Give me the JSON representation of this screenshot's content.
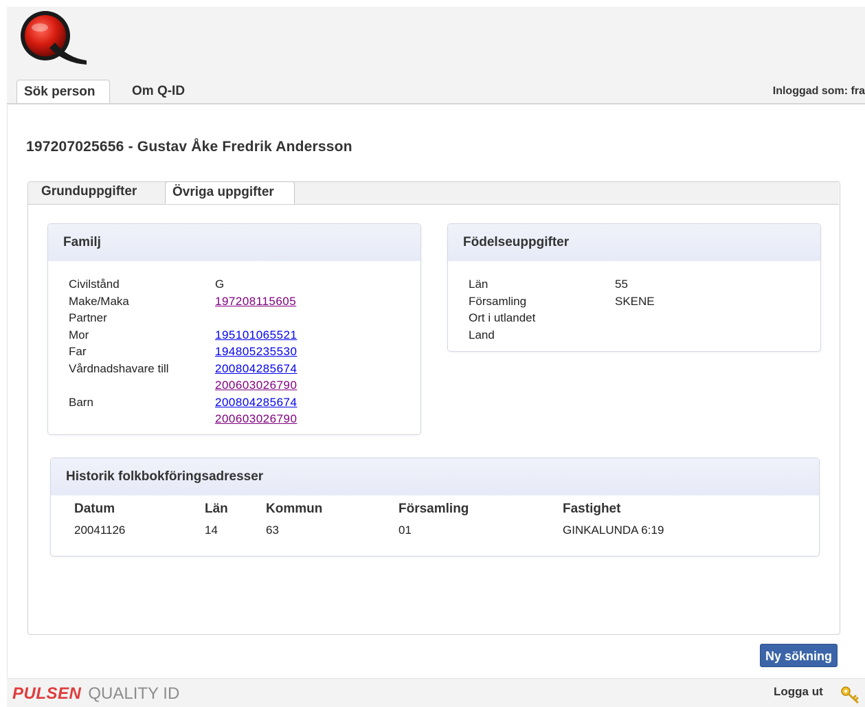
{
  "header": {
    "tabs": [
      {
        "label": "Sök person",
        "active": true
      },
      {
        "label": "Om Q-ID",
        "active": false
      }
    ],
    "logged_in_label": "Inloggad som: fra"
  },
  "person": {
    "title": "197207025656 - Gustav Åke Fredrik Andersson"
  },
  "content_tabs": [
    {
      "label": "Grunduppgifter",
      "active": false
    },
    {
      "label": "Övriga uppgifter",
      "active": true
    }
  ],
  "family": {
    "heading": "Familj",
    "labels": [
      "Civilstånd",
      "Make/Maka",
      "Partner",
      "Mor",
      "Far",
      "Vårdnadshavare till",
      "",
      "Barn",
      ""
    ],
    "civilstand": "G",
    "make_maka": "197208115605",
    "mor": "195101065521",
    "far": "194805235530",
    "vardnadshavare": [
      "200804285674",
      "200603026790"
    ],
    "barn": [
      "200804285674",
      "200603026790"
    ]
  },
  "birth": {
    "heading": "Födelseuppgifter",
    "labels": [
      "Län",
      "Församling",
      "Ort i utlandet",
      "Land"
    ],
    "values": [
      "55",
      "SKENE",
      "",
      ""
    ]
  },
  "history": {
    "heading": "Historik folkbokföringsadresser",
    "columns": [
      "Datum",
      "Län",
      "Kommun",
      "Församling",
      "Fastighet"
    ],
    "rows": [
      [
        "20041126",
        "14",
        "63",
        "01",
        "GINKALUNDA 6:19"
      ]
    ]
  },
  "actions": {
    "new_search_label": "Ny sökning",
    "logout_label": "Logga ut"
  },
  "footer": {
    "brand_primary": "PULSEN",
    "brand_secondary": "QUALITY ID"
  },
  "colors": {
    "accent_button": "#3b65a8",
    "brand_red": "#e03c3c",
    "link_unvisited": "#0000ee",
    "link_visited": "#800080"
  }
}
